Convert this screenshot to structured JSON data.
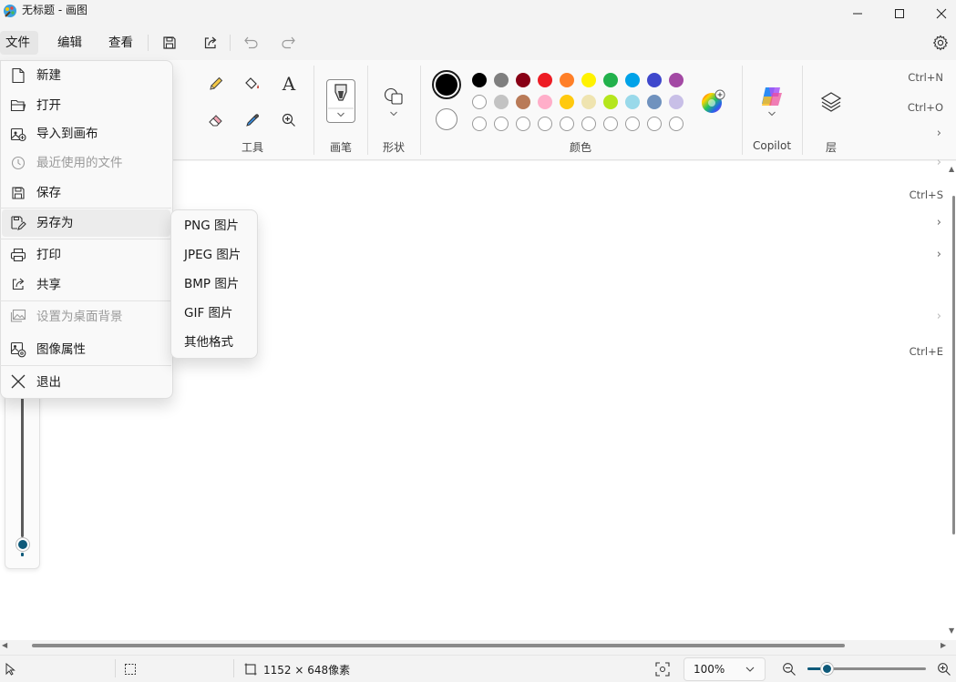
{
  "window": {
    "title": "无标题 - 画图"
  },
  "menubar": {
    "file": "文件",
    "edit": "编辑",
    "view": "查看"
  },
  "ribbon": {
    "tools_label": "工具",
    "brush_label": "画笔",
    "shapes_label": "形状",
    "colors_label": "颜色",
    "copilot_label": "Copilot",
    "layers_label": "层",
    "text_tool_glyph": "A",
    "palette_row1": [
      "#000000",
      "#7f7f7f",
      "#880015",
      "#ed1c24",
      "#ff7f27",
      "#fff200",
      "#22b14c",
      "#00a2e8",
      "#3f48cc",
      "#a349a4"
    ],
    "palette_row2": [
      "#ffffff",
      "#c3c3c3",
      "#b97a57",
      "#ffaec9",
      "#ffc90e",
      "#efe4b0",
      "#b5e61d",
      "#99d9ea",
      "#7092be",
      "#c8bfe7"
    ],
    "primary_color": "#000000",
    "secondary_color": "#ffffff"
  },
  "file_menu": {
    "items": [
      {
        "label": "新建",
        "shortcut": "Ctrl+N"
      },
      {
        "label": "打开",
        "shortcut": "Ctrl+O"
      },
      {
        "label": "导入到画布"
      },
      {
        "label": "最近使用的文件",
        "disabled": true
      },
      {
        "label": "保存",
        "shortcut": "Ctrl+S"
      },
      {
        "label": "另存为",
        "highlighted": true
      },
      {
        "label": "打印"
      },
      {
        "label": "共享"
      },
      {
        "label": "设置为桌面背景",
        "disabled": true
      },
      {
        "label": "图像属性",
        "shortcut": "Ctrl+E"
      },
      {
        "label": "退出"
      }
    ]
  },
  "saveas_submenu": {
    "items": [
      "PNG 图片",
      "JPEG 图片",
      "BMP 图片",
      "GIF 图片",
      "其他格式"
    ]
  },
  "statusbar": {
    "canvas_size": "1152 × 648像素",
    "zoom": "100%"
  },
  "accent_color": "#0f5a7a"
}
